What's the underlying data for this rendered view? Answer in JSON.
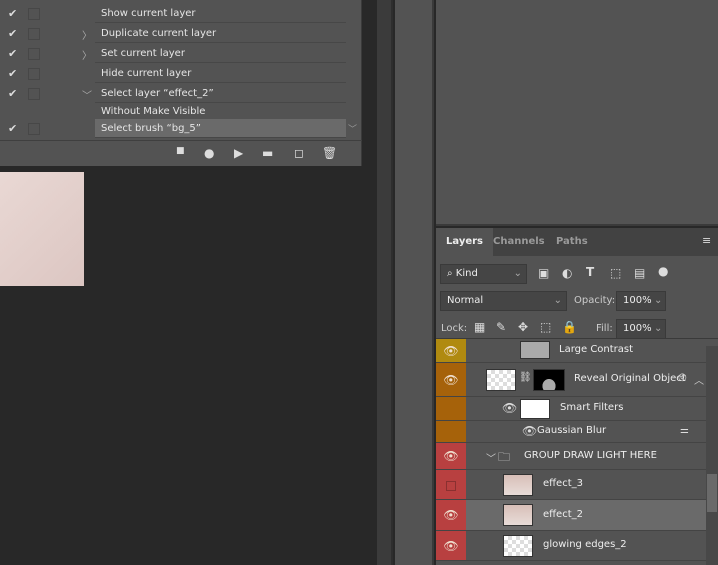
{
  "actions": {
    "items": [
      {
        "label": "Show current layer",
        "checked": true,
        "toggle": ""
      },
      {
        "label": "Duplicate current layer",
        "checked": true,
        "toggle": "〉"
      },
      {
        "label": "Set current layer",
        "checked": true,
        "toggle": "〉"
      },
      {
        "label": "Hide current layer",
        "checked": true,
        "toggle": ""
      },
      {
        "label": "Select layer “effect_2”",
        "checked": true,
        "toggle": "﹀"
      },
      {
        "label": "Without Make Visible",
        "checked": false,
        "toggle": ""
      },
      {
        "label": "Select brush “bg_5”",
        "checked": true,
        "toggle": "",
        "selected": true
      }
    ],
    "toolbar": [
      "stop-icon",
      "record-icon",
      "play-icon",
      "folder-icon",
      "new-action-icon",
      "trash-icon"
    ]
  },
  "layers_panel": {
    "tabs": [
      "Layers",
      "Channels",
      "Paths"
    ],
    "filter_kind": "Kind",
    "blend_mode": "Normal",
    "opacity_label": "Opacity:",
    "opacity": "100%",
    "lock_label": "Lock:",
    "fill_label": "Fill:",
    "fill": "100%",
    "layers": [
      {
        "name": "Large Contrast",
        "color": "#b08a10",
        "visible": true
      },
      {
        "name": "Reveal Original Object",
        "color": "#a6620a",
        "visible": true
      },
      {
        "name": "Smart Filters"
      },
      {
        "name": "Gaussian Blur"
      },
      {
        "name": "GROUP DRAW LIGHT HERE",
        "color": "#b84040",
        "visible": true
      },
      {
        "name": "effect_3",
        "color": "#b84040",
        "visible": false
      },
      {
        "name": "effect_2",
        "color": "#b84040",
        "visible": true,
        "selected": true
      },
      {
        "name": "glowing edges_2",
        "color": "#b84040",
        "visible": true
      }
    ]
  }
}
